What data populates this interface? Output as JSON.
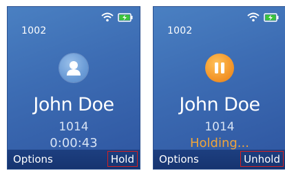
{
  "screens": [
    {
      "extension": "1002",
      "contact_name": "John Doe",
      "contact_number": "1014",
      "call_timer": "0:00:43",
      "softkey_left": "Options",
      "softkey_right": "Hold",
      "avatar_icon": "contact-icon"
    },
    {
      "extension": "1002",
      "contact_name": "John Doe",
      "contact_number": "1014",
      "status_text": "Holding...",
      "softkey_left": "Options",
      "softkey_right": "Unhold",
      "avatar_icon": "pause-icon"
    }
  ],
  "status_icons": [
    "wifi-icon",
    "battery-charging-icon"
  ],
  "colors": {
    "holding_text": "#f0a53a",
    "highlight_box": "#d62020"
  }
}
